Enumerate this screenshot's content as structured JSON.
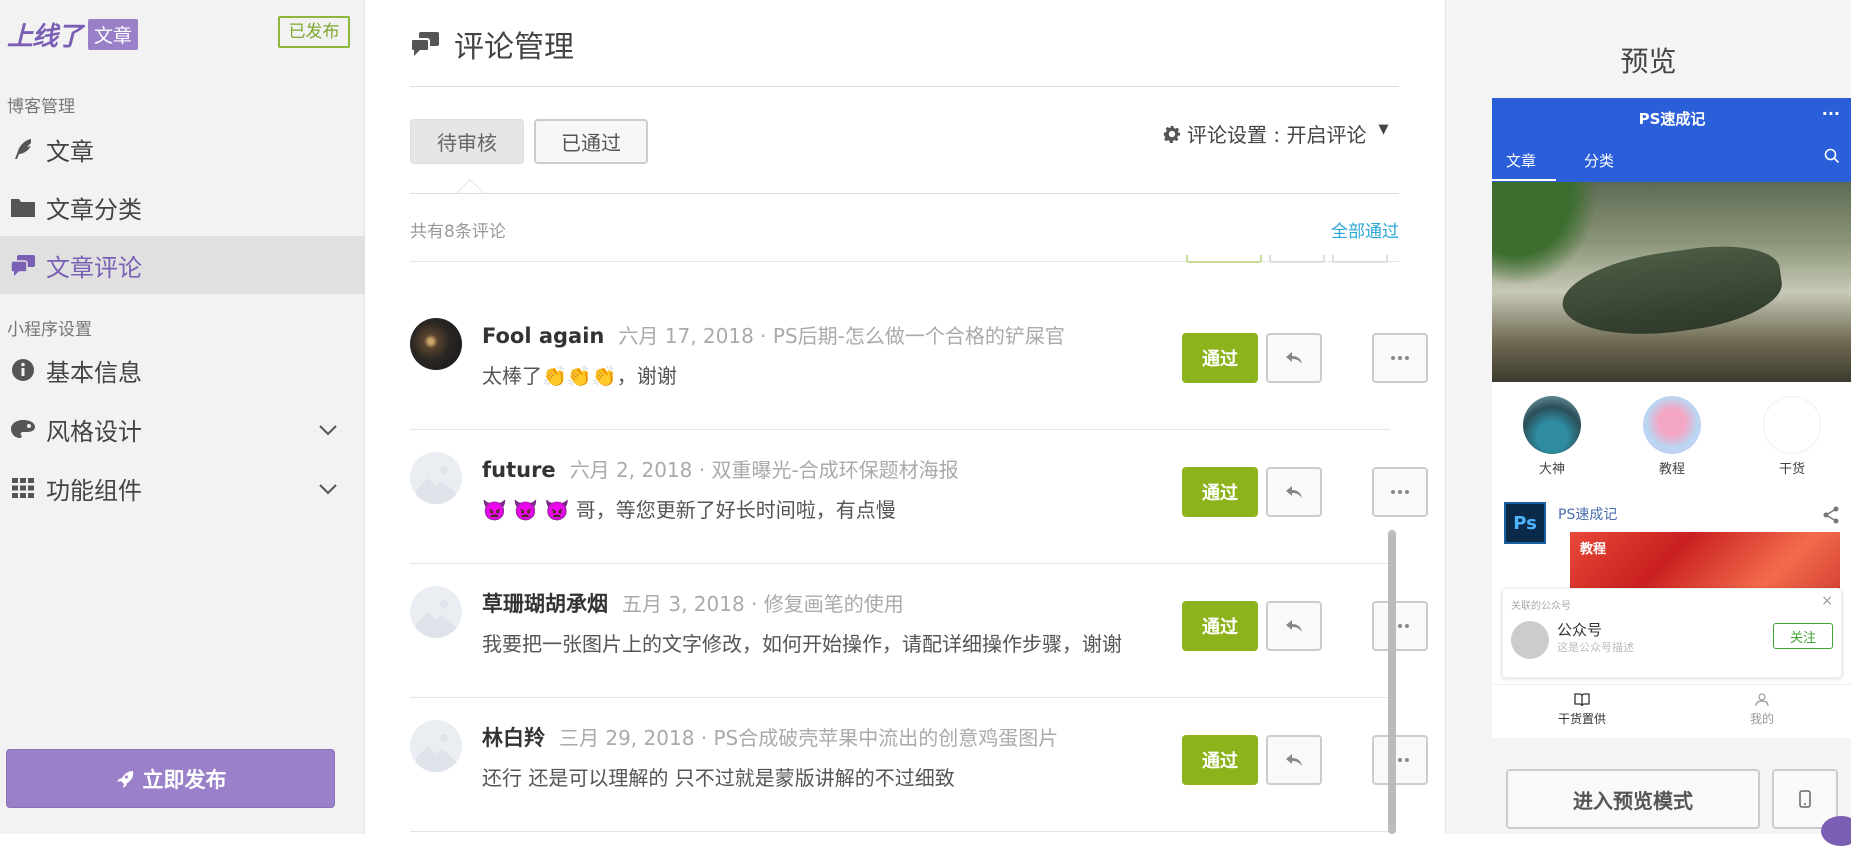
{
  "sidebar": {
    "logo_text": "上线了",
    "logo_badge": "文章",
    "published_badge": "已发布",
    "section_blog": "博客管理",
    "section_miniapp": "小程序设置",
    "items": [
      {
        "label": "文章",
        "icon": "feather-icon"
      },
      {
        "label": "文章分类",
        "icon": "folder-icon"
      },
      {
        "label": "文章评论",
        "icon": "comments-icon",
        "active": true
      },
      {
        "label": "基本信息",
        "icon": "info-icon"
      },
      {
        "label": "风格设计",
        "icon": "palette-icon"
      },
      {
        "label": "功能组件",
        "icon": "grid-icon"
      }
    ],
    "publish_button": "立即发布"
  },
  "main": {
    "title": "评论管理",
    "tabs": [
      {
        "label": "待审核",
        "active": true
      },
      {
        "label": "已通过",
        "active": false
      }
    ],
    "settings_label": "评论设置 : 开启评论",
    "count_text": "共有8条评论",
    "approve_all": "全部通过",
    "comments": [
      {
        "name": "Fool again",
        "meta": "六月 17, 2018 · PS后期-怎么做一个合格的铲屎官",
        "body": "太棒了👏👏👏，谢谢",
        "approve": "通过"
      },
      {
        "name": "future",
        "meta": "六月 2, 2018 · 双重曝光-合成环保题材海报",
        "body": "👿 👿 👿 哥，等您更新了好长时间啦，有点慢",
        "approve": "通过"
      },
      {
        "name": "草珊瑚胡承烟",
        "meta": "五月 3, 2018 · 修复画笔的使用",
        "body": "我要把一张图片上的文字修改，如何开始操作，请配详细操作步骤，谢谢",
        "approve": "通过"
      },
      {
        "name": "林白羚",
        "meta": "三月 29, 2018 · PS合成破壳苹果中流出的创意鸡蛋图片",
        "body": "还行 还是可以理解的 只不过就是蒙版讲解的不过细致",
        "approve": "通过"
      }
    ]
  },
  "preview": {
    "title": "预览",
    "phone": {
      "app_title": "PS速成记",
      "menu": "···",
      "tabs": [
        "文章",
        "分类"
      ],
      "categories": [
        "大神",
        "教程",
        "干货"
      ],
      "account_name": "PS速成记",
      "ps_logo": "Ps",
      "article_tag": "教程",
      "follow_card": {
        "label": "关联的公众号",
        "name": "公众号",
        "desc": "这是公众号描述",
        "follow": "关注",
        "close": "×"
      },
      "bottom_tabs": [
        "干货置供",
        "我的"
      ]
    },
    "enter_button": "进入预览模式"
  },
  "colors": {
    "accent": "#9a7fc9",
    "approve": "#8cb31b",
    "link": "#2aa6d8",
    "phone_header": "#2b5fd9"
  }
}
